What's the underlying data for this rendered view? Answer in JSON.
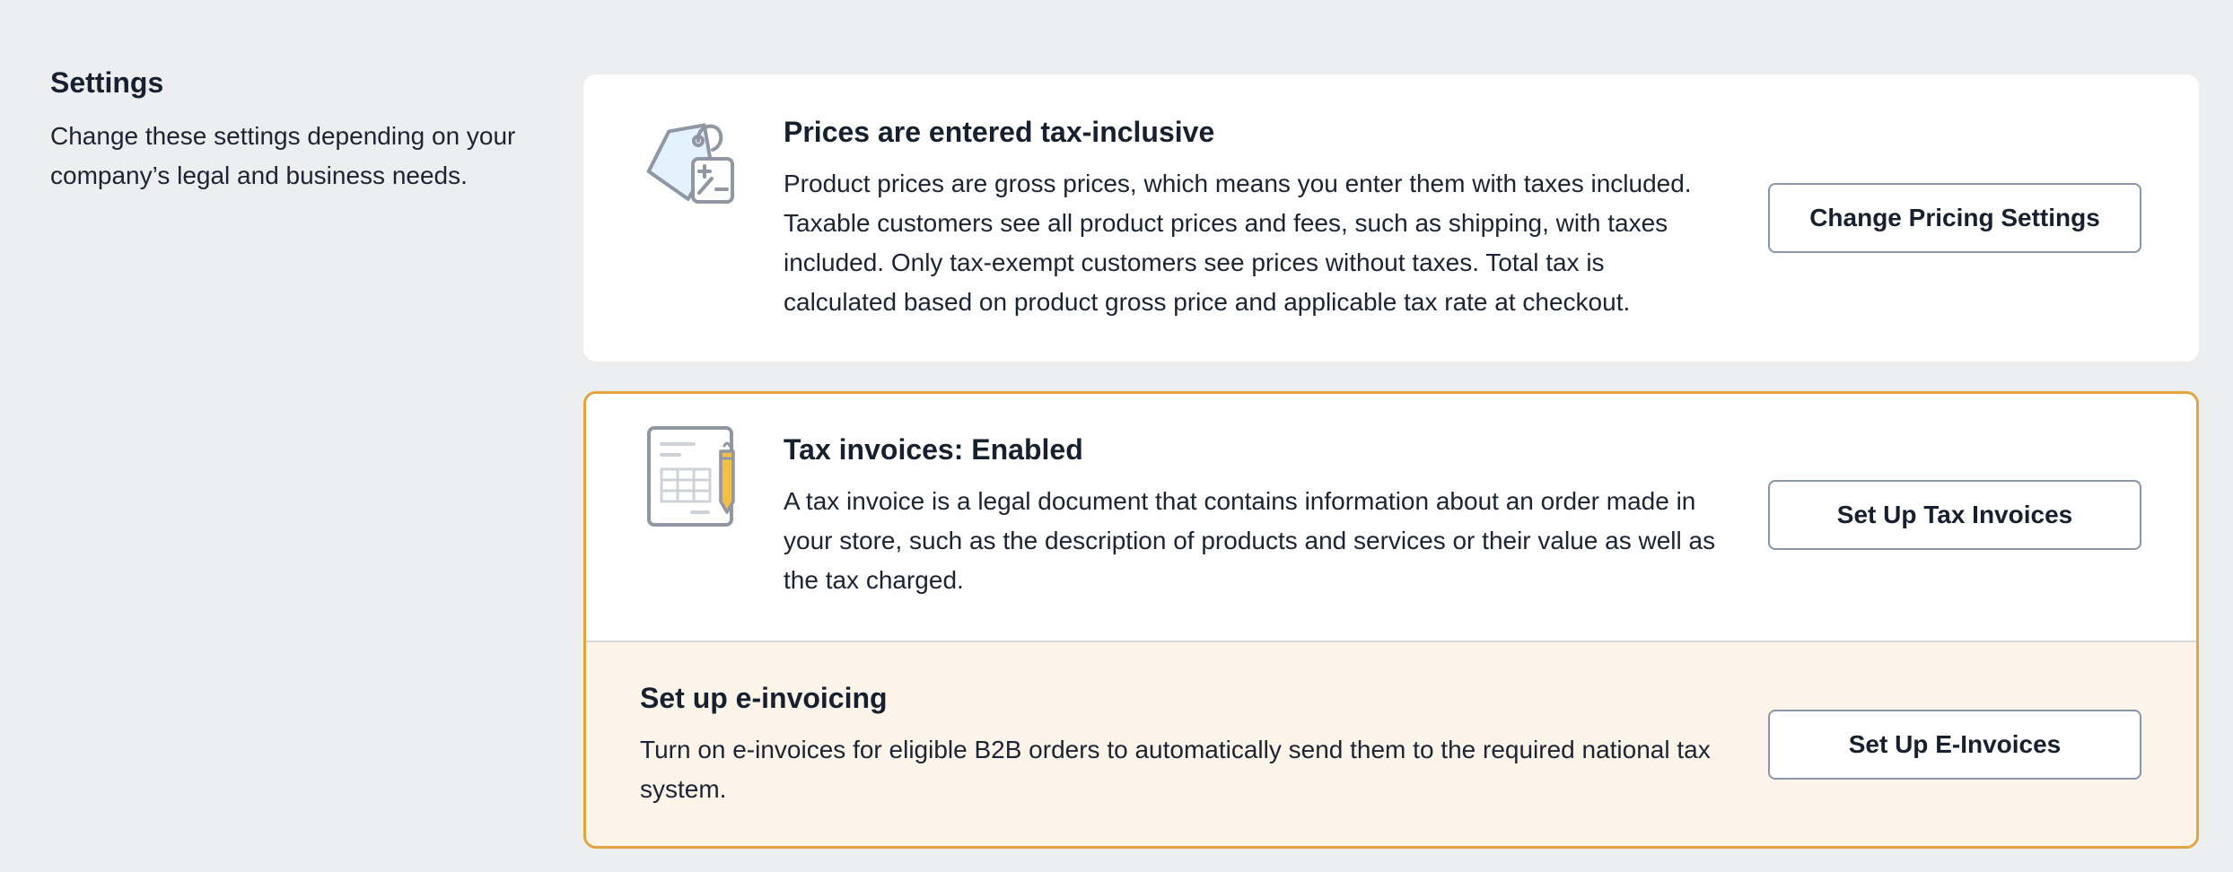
{
  "settings": {
    "title": "Settings",
    "description": "Change these settings depending on your company’s legal and business needs."
  },
  "pricing": {
    "icon": "price-tag-tax-icon",
    "title": "Prices are entered tax-inclusive",
    "description": "Product prices are gross prices, which means you enter them with taxes included. Taxable customers see all product prices and fees, such as shipping, with taxes included. Only tax-exempt customers see prices without taxes. Total tax is calculated based on product gross price and applicable tax rate at checkout.",
    "button_label": "Change Pricing Settings"
  },
  "tax_invoices": {
    "icon": "invoice-document-icon",
    "title": "Tax invoices: Enabled",
    "description": "A tax invoice is a legal document that contains information about an order made in your store, such as the description of products and services or their value as well as the tax charged.",
    "button_label": "Set Up Tax Invoices"
  },
  "e_invoicing": {
    "title": "Set up e-invoicing",
    "description": "Turn on e-invoices for eligible B2B orders to automatically send them to the required national tax system.",
    "button_label": "Set Up E-Invoices"
  },
  "colors": {
    "page_background": "#edeef0",
    "card_background": "#ffffff",
    "highlight_border": "#e3a33d",
    "highlight_background": "#fcf4e8",
    "icon_stroke": "#8f97a3",
    "icon_fill_blue": "#e3f2fc",
    "icon_fill_yellow": "#f2c04a"
  }
}
